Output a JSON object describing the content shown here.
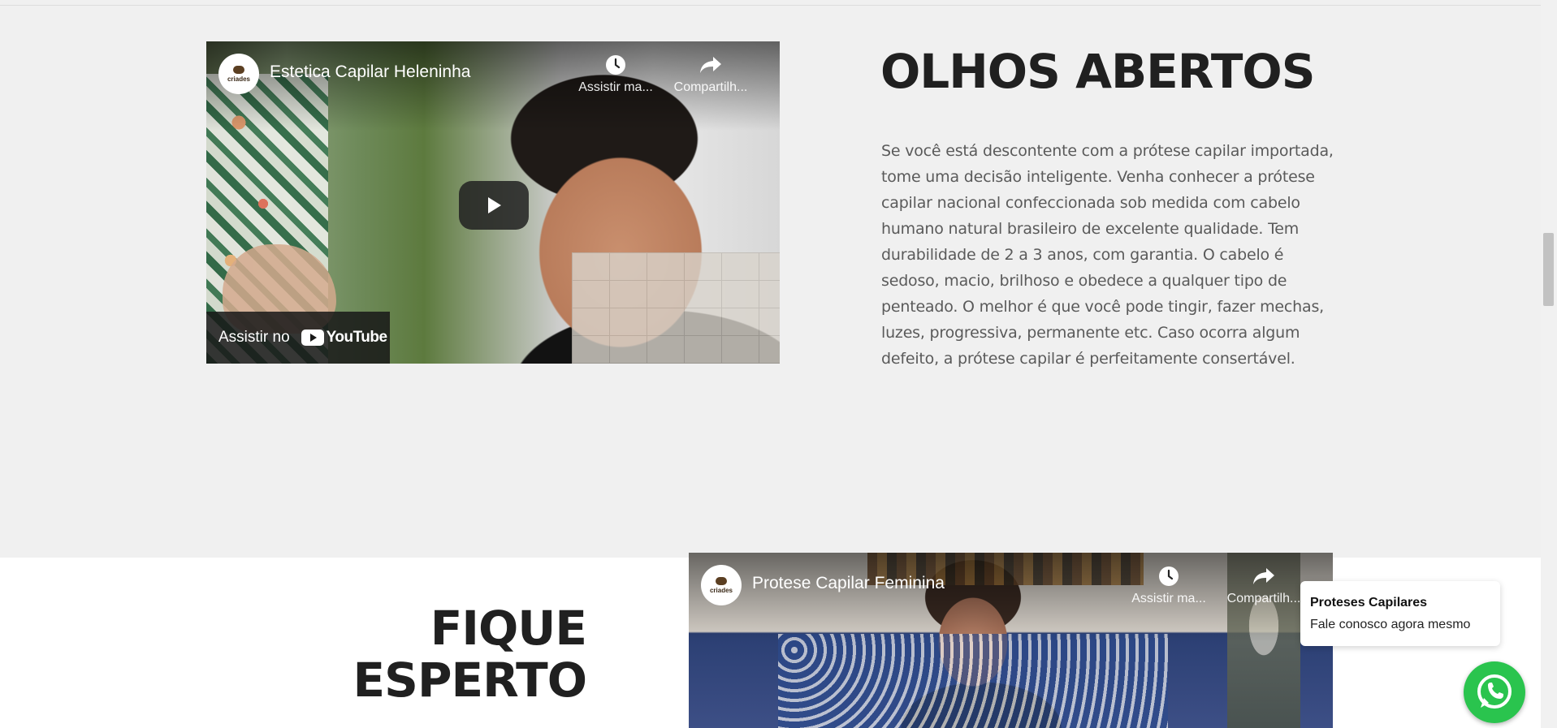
{
  "section_1": {
    "video": {
      "title": "Estetica Capilar Heleninha",
      "channel_logo_text": "criades",
      "watch_later_label": "Assistir ma...",
      "share_label": "Compartilh...",
      "watch_on_label": "Assistir no",
      "youtube_word": "YouTube"
    },
    "heading": "OLHOS ABERTOS",
    "paragraph": "Se você está descontente com a prótese capilar importada, tome uma decisão inteligente. Venha conhecer a prótese capilar nacional confeccionada sob medida com cabelo humano natural brasileiro de excelente qualidade. Tem durabilidade de 2 a 3 anos, com garantia. O cabelo é sedoso, macio, brilhoso e obedece a qualquer tipo de penteado. O melhor é que você pode tingir, fazer mechas, luzes, progressiva, permanente etc. Caso ocorra algum defeito, a prótese capilar é perfeitamente consertável."
  },
  "section_2": {
    "heading_line_1": "FIQUE",
    "heading_line_2": "ESPERTO",
    "video": {
      "title": "Protese Capilar Feminina",
      "channel_logo_text": "criades",
      "watch_later_label": "Assistir ma...",
      "share_label": "Compartilh..."
    }
  },
  "whatsapp": {
    "popup_title": "Proteses Capilares",
    "popup_subtitle": "Fale conosco agora mesmo",
    "icon": "whatsapp-icon",
    "color": "#2ac44e"
  },
  "colors": {
    "background_section_1": "#f0f0f0",
    "background_section_2": "#ffffff",
    "heading": "#202020",
    "body_text": "#5a5a5a",
    "youtube_red": "#ff0000"
  }
}
